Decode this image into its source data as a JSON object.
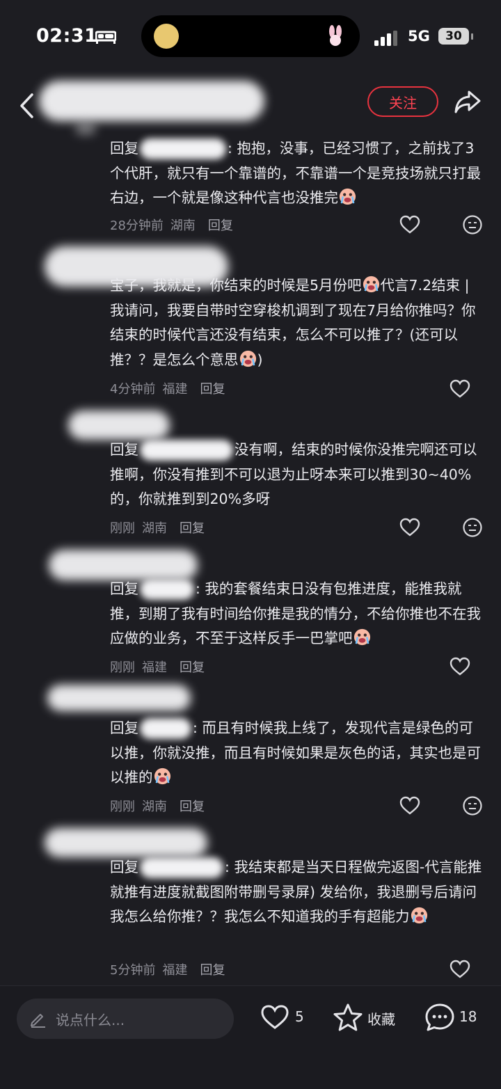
{
  "status_bar": {
    "time": "02:31",
    "network": "5G",
    "battery": "30"
  },
  "header": {
    "follow_label": "关注"
  },
  "comments": [
    {
      "prefix": "回复",
      "text": ": 抱抱，没事，已经习惯了，之前找了3个代肝，就只有一个靠谱的，不靠谱一个是竞技场就只打最右边，一个就是像这种代言也没推完",
      "time": "28分钟前",
      "location": "湖南",
      "reply_label": "回复"
    },
    {
      "text": "宝子，我就是，你结束的时候是5月份吧",
      "text2": "代言7.2结束 | 我请问，我要自带时空穿梭机调到了现在7月给你推吗？你结束的时候代言还没有结束，怎么不可以推了？(还可以推？？是怎么个意思",
      "text3": ")",
      "time": "4分钟前",
      "location": "福建",
      "reply_label": "回复"
    },
    {
      "prefix": "回复",
      "text": "没有啊，结束的时候你没推完啊还可以推啊，你没有推到不可以退为止呀本来可以推到30~40%的，你就推到到20%多呀",
      "time": "刚刚",
      "location": "湖南",
      "reply_label": "回复"
    },
    {
      "prefix": "回复",
      "text": ": 我的套餐结束日没有包推进度，能推我就推，到期了我有时间给你推是我的情分，不给你推也不在我应做的业务，不至于这样反手一巴掌吧",
      "time": "刚刚",
      "location": "福建",
      "reply_label": "回复"
    },
    {
      "prefix": "回复",
      "text": ": 而且有时候我上线了，发现代言是绿色的可以推，你就没推，而且有时候如果是灰色的话，其实也是可以推的",
      "time": "刚刚",
      "location": "湖南",
      "reply_label": "回复"
    },
    {
      "prefix": "回复",
      "text": ": 我结束都是当天日程做完返图-代言能推就推有进度就截图附带删号录屏) 发给你，我退删号后请问我怎么给你推？？我怎么不知道我的手有超能力",
      "time": "5分钟前",
      "location": "福建",
      "reply_label": "回复"
    }
  ],
  "bottom_bar": {
    "input_placeholder": "说点什么...",
    "like_count": "5",
    "collect_label": "收藏",
    "comment_count": "18"
  },
  "colors": {
    "background": "#1d1d22",
    "accent": "#ff4452",
    "meta": "#8e8e96"
  }
}
